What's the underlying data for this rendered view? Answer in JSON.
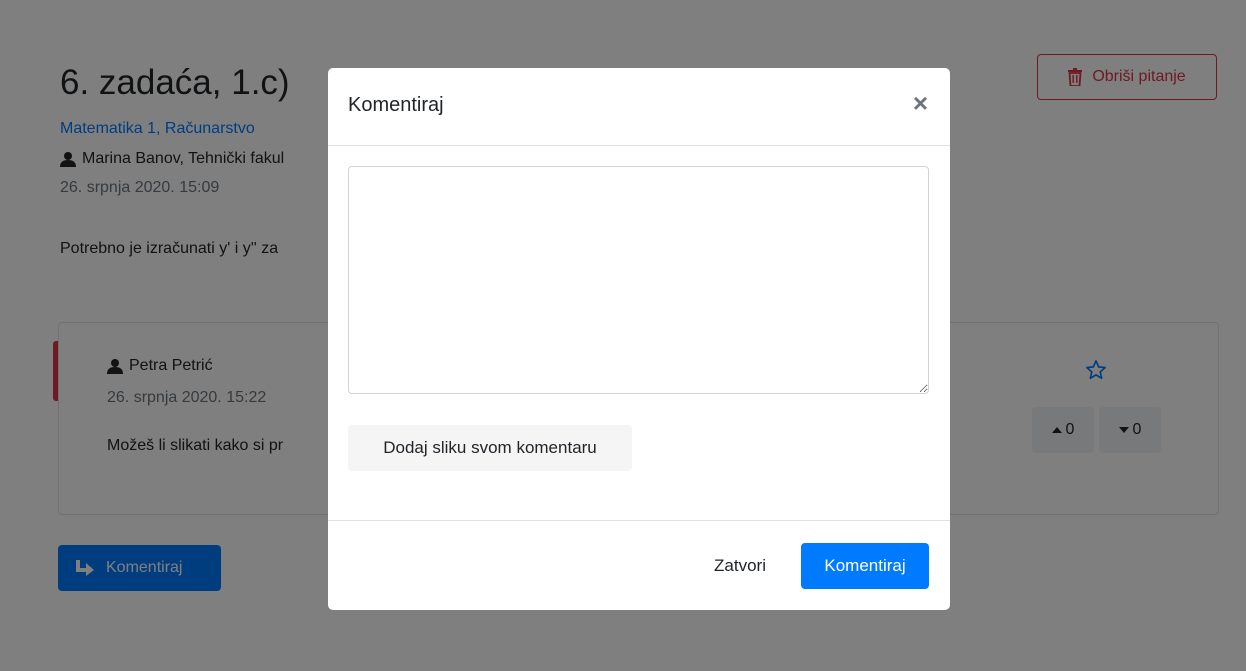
{
  "question": {
    "title": "6. zadaća, 1.c)",
    "delete_label": "Obriši pitanje",
    "subject": "Matematika 1, Računarstvo",
    "author": "Marina Banov, Tehnički fakul",
    "date": "26. srpnja 2020. 15:09",
    "body": "Potrebno je izračunati y' i y'' za"
  },
  "answer": {
    "author": "Petra Petrić",
    "date": "26. srpnja 2020. 15:22",
    "body": "Možeš li slikati kako si pr",
    "upvotes": "0",
    "downvotes": "0"
  },
  "comment_button_label": "Komentiraj",
  "modal": {
    "title": "Komentiraj",
    "close_symbol": "×",
    "textarea_value": "",
    "add_image_label": "Dodaj sliku svom komentaru",
    "close_label": "Zatvori",
    "submit_label": "Komentiraj"
  },
  "colors": {
    "primary": "#007bff",
    "danger": "#dc3545",
    "backdrop": "rgba(0,0,0,0.5)"
  },
  "icons": [
    "trash-icon",
    "user-icon",
    "star-outline-icon",
    "caret-up-icon",
    "caret-down-icon",
    "reply-icon"
  ]
}
